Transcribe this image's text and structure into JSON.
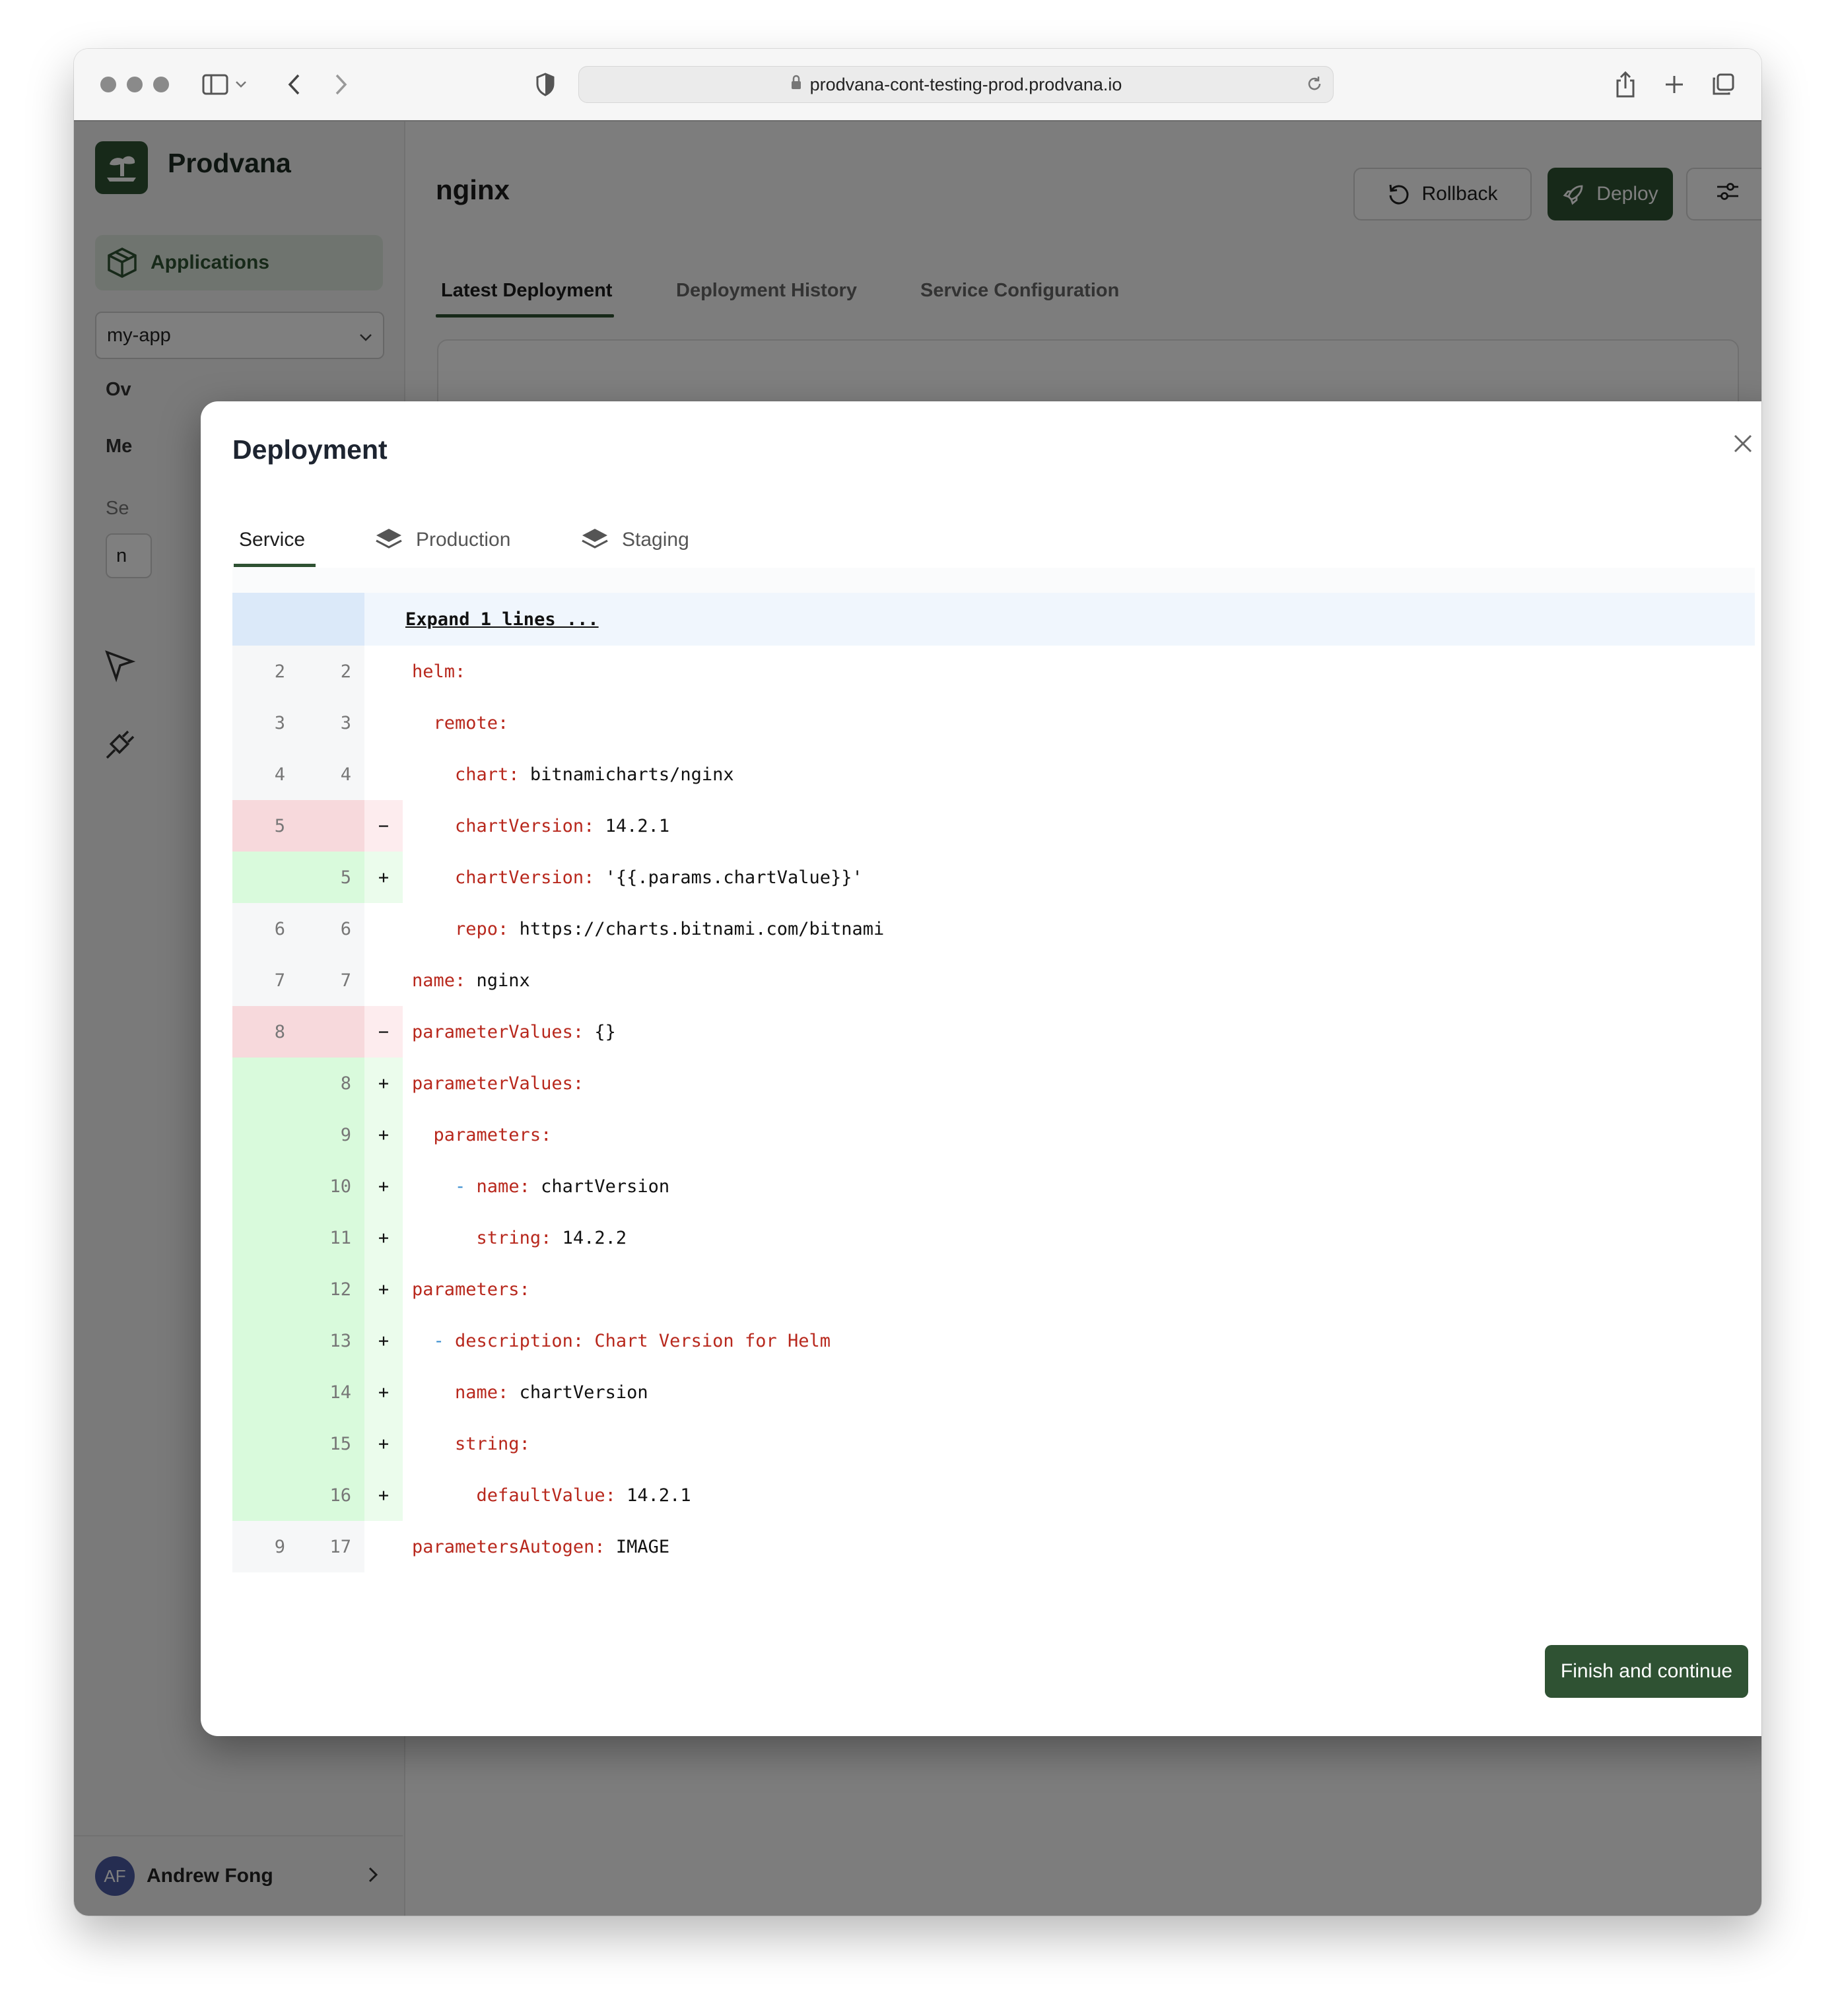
{
  "browser": {
    "url": "prodvana-cont-testing-prod.prodvana.io"
  },
  "sidebar": {
    "brand": "Prodvana",
    "nav_applications": "Applications",
    "app_select_value": "my-app",
    "frag_overview": "Ov",
    "frag_me": "Me",
    "frag_se": "Se",
    "frag_input": "n",
    "user": {
      "initials": "AF",
      "name": "Andrew Fong"
    }
  },
  "main": {
    "title": "nginx",
    "rollback_label": "Rollback",
    "deploy_label": "Deploy",
    "tabs": [
      "Latest Deployment",
      "Deployment History",
      "Service Configuration"
    ]
  },
  "modal": {
    "title": "Deployment",
    "tabs": [
      "Service",
      "Production",
      "Staging"
    ],
    "expand_label": "Expand 1 lines ...",
    "finish_label": "Finish and continue"
  },
  "diff_lines": [
    {
      "type": "context",
      "old": "2",
      "new": "2",
      "marker": "",
      "indent": "",
      "key": "helm:",
      "value": ""
    },
    {
      "type": "context",
      "old": "3",
      "new": "3",
      "marker": "",
      "indent": "  ",
      "key": "remote:",
      "value": ""
    },
    {
      "type": "context",
      "old": "4",
      "new": "4",
      "marker": "",
      "indent": "    ",
      "key": "chart:",
      "value": " bitnamicharts/nginx"
    },
    {
      "type": "del",
      "old": "5",
      "new": "",
      "marker": "−",
      "indent": "    ",
      "key": "chartVersion:",
      "value": " 14.2.1"
    },
    {
      "type": "add",
      "old": "",
      "new": "5",
      "marker": "+",
      "indent": "    ",
      "key": "chartVersion:",
      "value": " '{{.params.chartValue}}'"
    },
    {
      "type": "context",
      "old": "6",
      "new": "6",
      "marker": "",
      "indent": "    ",
      "key": "repo:",
      "value": " https://charts.bitnami.com/bitnami"
    },
    {
      "type": "context",
      "old": "7",
      "new": "7",
      "marker": "",
      "indent": "",
      "key": "name:",
      "value": " nginx"
    },
    {
      "type": "del",
      "old": "8",
      "new": "",
      "marker": "−",
      "indent": "",
      "key": "parameterValues:",
      "value": " {}"
    },
    {
      "type": "add",
      "old": "",
      "new": "8",
      "marker": "+",
      "indent": "",
      "key": "parameterValues:",
      "value": ""
    },
    {
      "type": "add",
      "old": "",
      "new": "9",
      "marker": "+",
      "indent": "  ",
      "key": "parameters:",
      "value": ""
    },
    {
      "type": "add",
      "old": "",
      "new": "10",
      "marker": "+",
      "indent": "    ",
      "dash": "- ",
      "key": "name:",
      "value": " chartVersion"
    },
    {
      "type": "add",
      "old": "",
      "new": "11",
      "marker": "+",
      "indent": "      ",
      "key": "string:",
      "value": " 14.2.2"
    },
    {
      "type": "add",
      "old": "",
      "new": "12",
      "marker": "+",
      "indent": "",
      "key": "parameters:",
      "value": ""
    },
    {
      "type": "add",
      "old": "",
      "new": "13",
      "marker": "+",
      "indent": "  ",
      "dash": "- ",
      "key": "description:",
      "value": " Chart Version for Helm",
      "value_red": true
    },
    {
      "type": "add",
      "old": "",
      "new": "14",
      "marker": "+",
      "indent": "    ",
      "key": "name:",
      "value": " chartVersion"
    },
    {
      "type": "add",
      "old": "",
      "new": "15",
      "marker": "+",
      "indent": "    ",
      "key": "string:",
      "value": ""
    },
    {
      "type": "add",
      "old": "",
      "new": "16",
      "marker": "+",
      "indent": "      ",
      "key": "defaultValue:",
      "value": " 14.2.1"
    },
    {
      "type": "context",
      "old": "9",
      "new": "17",
      "marker": "",
      "indent": "",
      "key": "parametersAutogen:",
      "value": " IMAGE"
    }
  ],
  "colors": {
    "brand_green": "#2f5233",
    "diff_del": "#f7d9dc",
    "diff_add": "#d9fadc",
    "yaml_key": "#b8281d"
  }
}
